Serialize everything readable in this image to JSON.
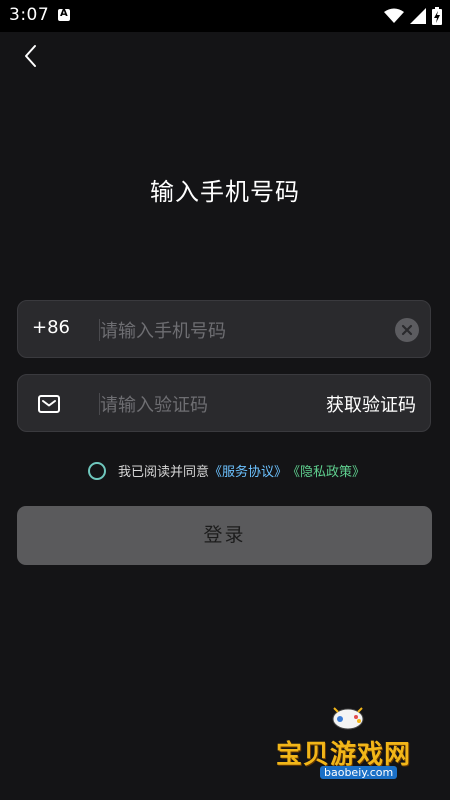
{
  "status_bar": {
    "time": "3:07",
    "notification_icon": "accessibility-a-icon",
    "icons": [
      "wifi-icon",
      "signal-icon",
      "battery-charging-icon"
    ]
  },
  "header": {
    "back_icon": "chevron-left-icon",
    "title": "输入手机号码"
  },
  "phone_field": {
    "country_code": "+86",
    "placeholder": "请输入手机号码",
    "value": "",
    "clear_icon": "clear-circle-icon"
  },
  "code_field": {
    "icon": "envelope-icon",
    "placeholder": "请输入验证码",
    "value": "",
    "get_code_label": "获取验证码"
  },
  "agreement": {
    "checked": false,
    "text": "我已阅读并同意",
    "service_link": "《服务协议》",
    "privacy_link": "《隐私政策》"
  },
  "login_button": {
    "label": "登录"
  },
  "watermark": {
    "brand": "宝贝游戏网",
    "url": "baobeiy.com"
  },
  "colors": {
    "background": "#141416",
    "field_bg": "#2a2a2d",
    "button_disabled": "#5a5a5c",
    "link_service": "#6cc2ff",
    "link_privacy": "#5fd08f",
    "radio_border": "#6fc7bd"
  }
}
